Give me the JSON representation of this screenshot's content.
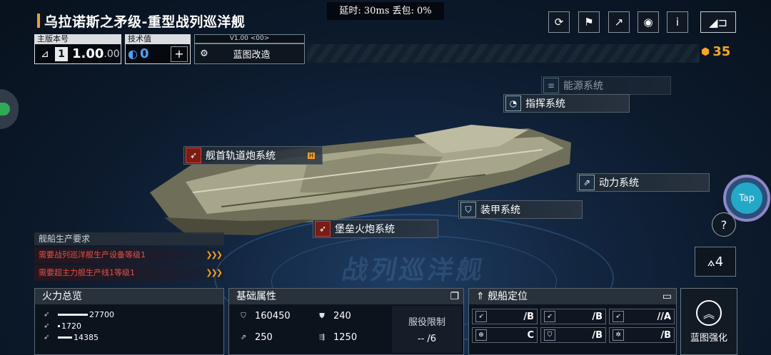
{
  "ship_title": "乌拉诺斯之矛级-重型战列巡洋舰",
  "latency_text": "延时: 30ms 丢包: 0%",
  "version": {
    "label": "主版本号",
    "major": "1",
    "value": "1.00",
    ".suffix": "",
    "minor": ".00"
  },
  "tech": {
    "label": "技术值",
    "value": "0",
    "add": "+"
  },
  "blueprint": {
    "version": "V1.00 <00>",
    "label": "蓝图改造"
  },
  "credits": "35",
  "systems": {
    "energy": "能源系统",
    "command": "指挥系统",
    "main_gun": "舰首轨道炮系统",
    "main_gun_tag": "H",
    "power": "动力系统",
    "armor": "装甲系统",
    "fortress": "堡垒火炮系统"
  },
  "production": {
    "title": "舰船生产要求",
    "req1": "需要战列巡洋舰生产设备等级1",
    "req2": "需要超主力舰生产线1等级1"
  },
  "firepower": {
    "title": "火力总览",
    "v1": "27700",
    "v2": "1720",
    "v3": "14385"
  },
  "base": {
    "title": "基础属性",
    "hp": "160450",
    "armor": "240",
    "speed": "250",
    "hull": "1250",
    "service_label": "服役限制",
    "service_value": "-- /6"
  },
  "position": {
    "title": "舰船定位",
    "r1": [
      "/B",
      "/B",
      "//A"
    ],
    "r2": [
      "C",
      "/B",
      "/B"
    ]
  },
  "blueprint_upgrade": "蓝图强化",
  "tap": "Tap",
  "floor_text": "战列巡洋舰"
}
